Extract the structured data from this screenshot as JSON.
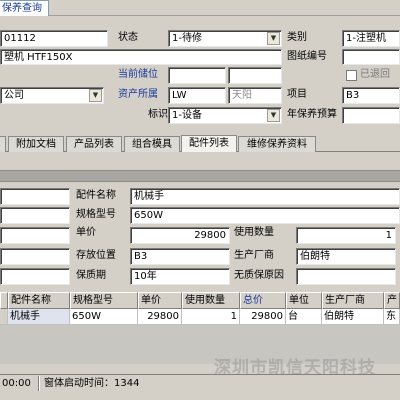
{
  "window": {
    "tab_title": "保养查询"
  },
  "form": {
    "code_value": "01112",
    "status_label": "状态",
    "status_value": "1-待修",
    "category_label": "类别",
    "category_value": "1-注塑机",
    "name_value": "塑机 HTF150X",
    "drawing_no_label": "图纸编号",
    "drawing_no_value": "",
    "current_pos_label": "当前储位",
    "retired_label": "已退回",
    "company_value": "公司",
    "asset_owner_label": "资产所属",
    "asset_owner_value": "LW",
    "asset_owner_value2": "天阳",
    "project_label": "项目",
    "project_value": "B3",
    "mark_label": "标识",
    "mark_value": "1-设备",
    "budget_label": "年保养预算",
    "budget_value": ""
  },
  "tabs": [
    {
      "label": "附加文档"
    },
    {
      "label": "产品列表"
    },
    {
      "label": "组合模具"
    },
    {
      "label": "配件列表"
    },
    {
      "label": "维修保养资料"
    }
  ],
  "detail": {
    "part_name_label": "配件名称",
    "part_name_value": "机械手",
    "spec_label": "规格型号",
    "spec_value": "650W",
    "unit_price_label": "单价",
    "unit_price_value": "29800",
    "usage_qty_label": "使用数量",
    "usage_qty_value": "1",
    "location_label": "存放位置",
    "location_value": "B3",
    "maker_label": "生产厂商",
    "maker_value": "伯朗特",
    "warranty_label": "保质期",
    "warranty_value": "10年",
    "no_warranty_label": "无质保原因",
    "no_warranty_value": ""
  },
  "grid": {
    "headers": [
      "配件名称",
      "规格型号",
      "单价",
      "使用数量",
      "总价",
      "单位",
      "生产厂商",
      "产"
    ],
    "rows": [
      [
        "机械手",
        "650W",
        "29800",
        "1",
        "29800",
        "台",
        "伯朗特",
        "东"
      ]
    ]
  },
  "status": {
    "time": "00:00",
    "startup_label": "窗体启动时间：1344"
  },
  "watermark": "深圳市凯信天阳科技",
  "colors": {
    "blue_label": "#1a3a9a",
    "background": "#d4d0c8"
  }
}
